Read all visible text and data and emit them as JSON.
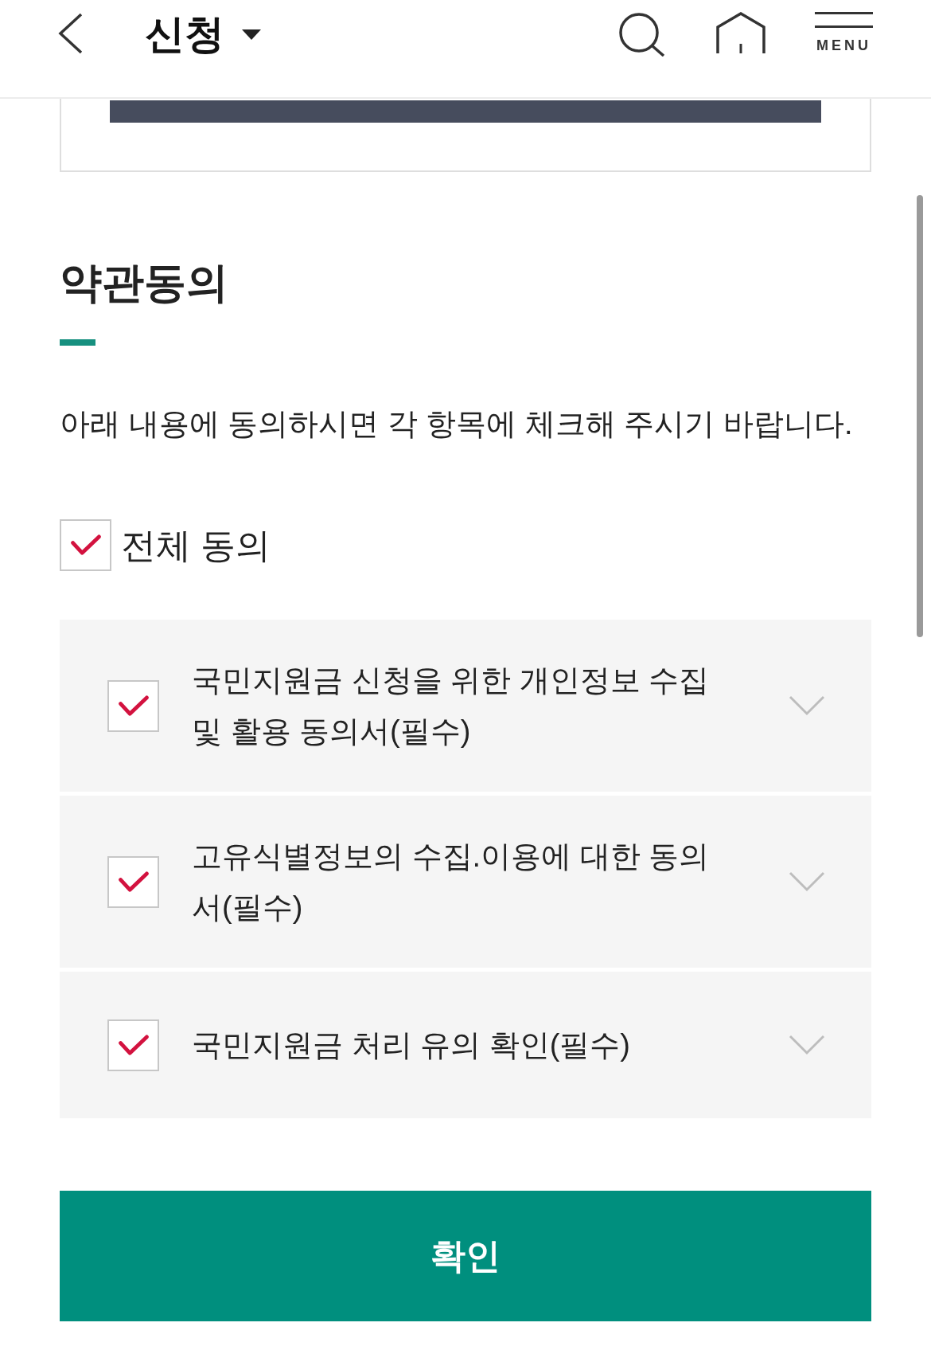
{
  "header": {
    "title": "신청",
    "menu_label": "MENU"
  },
  "agreement": {
    "title": "약관동의",
    "instruction": "아래 내용에 동의하시면 각 항목에 체크해 주시기 바랍니다.",
    "agree_all": {
      "label": "전체 동의",
      "checked": true
    },
    "items": [
      {
        "label": "국민지원금 신청을 위한 개인정보 수집 및 활용 동의서(필수)",
        "checked": true,
        "expanded": false
      },
      {
        "label": "고유식별정보의 수집.이용에 대한 동의서(필수)",
        "checked": true,
        "expanded": false
      },
      {
        "label": "국민지원금 처리 유의 확인(필수)",
        "checked": true,
        "expanded": false
      }
    ]
  },
  "confirm_button": {
    "label": "확인"
  }
}
